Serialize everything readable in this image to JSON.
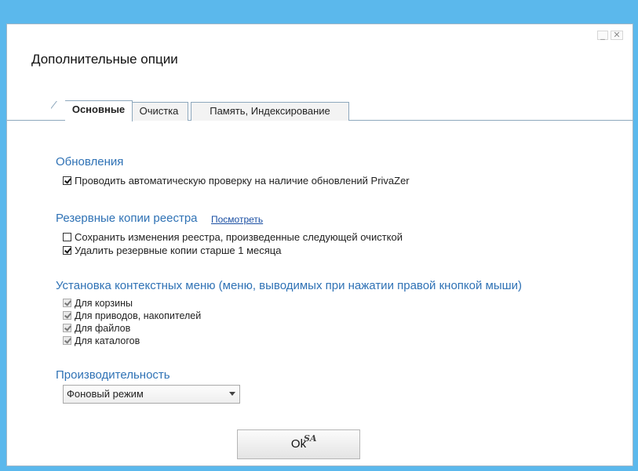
{
  "window": {
    "title": "Дополнительные опции",
    "minimize_glyph": "_",
    "close_glyph": "✕"
  },
  "tabs": [
    {
      "label": "Основные",
      "active": true
    },
    {
      "label": "Очистка",
      "active": false
    },
    {
      "label": "Память, Индексирование",
      "active": false
    }
  ],
  "updates": {
    "title": "Обновления",
    "items": [
      {
        "label": "Проводить автоматическую проверку на наличие обновлений PrivaZer",
        "checked": true
      }
    ]
  },
  "registry": {
    "title": "Резервные копии реестра",
    "link": "Посмотреть",
    "items": [
      {
        "label": "Сохранить изменения реестра, произведенные следующей очисткой",
        "checked": false
      },
      {
        "label": "Удалить резервные копии старше 1 месяца",
        "checked": true
      }
    ]
  },
  "context_menu": {
    "title": "Установка контекстных меню (меню, выводимых при нажатии правой кнопкой мыши)",
    "items": [
      {
        "label": "Для корзины",
        "checked": true,
        "disabled": true
      },
      {
        "label": "Для приводов, накопителей",
        "checked": true,
        "disabled": true
      },
      {
        "label": "Для файлов",
        "checked": true,
        "disabled": true
      },
      {
        "label": "Для каталогов",
        "checked": true,
        "disabled": true
      }
    ]
  },
  "performance": {
    "title": "Производительность",
    "selected": "Фоновый режим"
  },
  "ok_label": "Ok",
  "signature": "SA",
  "colors": {
    "background": "#5bb8ec",
    "section_title": "#2f72b5",
    "link": "#1a4fa3"
  }
}
